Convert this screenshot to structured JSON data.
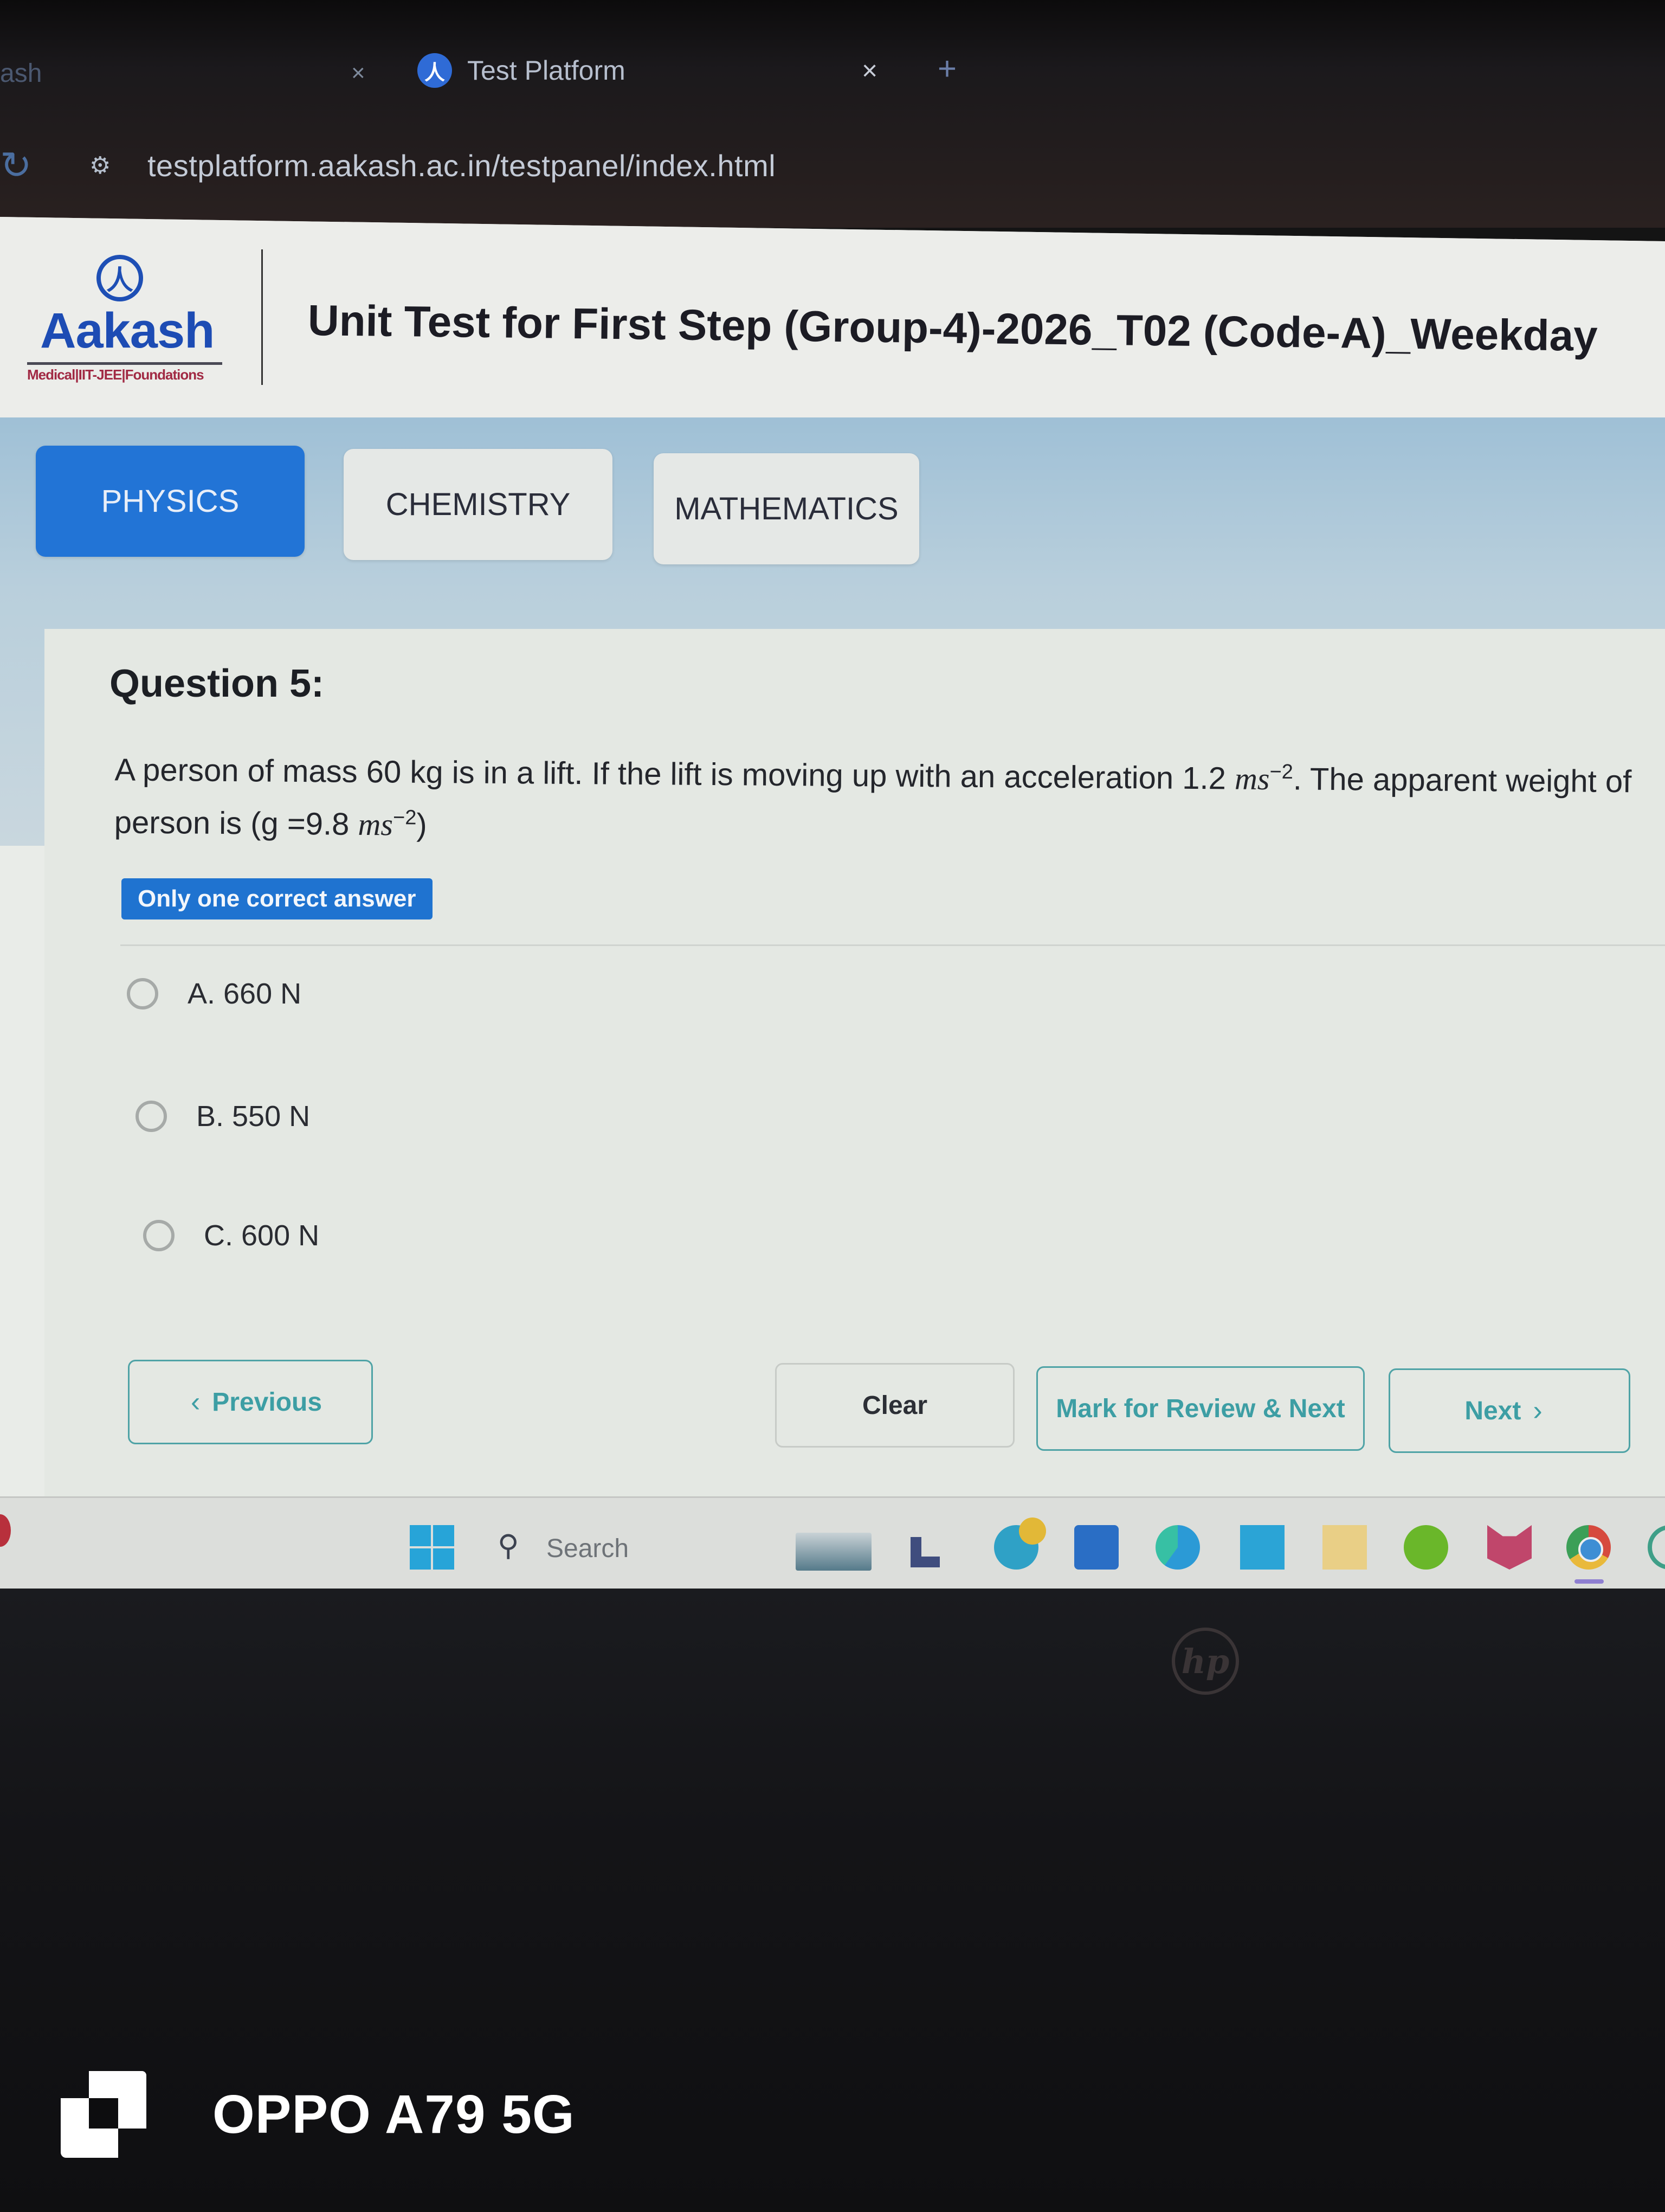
{
  "browser": {
    "tabs": [
      {
        "title": "ash",
        "close": "×",
        "active": false
      },
      {
        "title": "Test Platform",
        "close": "×",
        "active": true,
        "favicon": "aakash-favicon-icon"
      }
    ],
    "new_tab": "+",
    "reload_icon": "↻",
    "site_info_icon": "⚙",
    "url": "testplatform.aakash.ac.in/testpanel/index.html"
  },
  "header": {
    "logo": {
      "emblem": "人",
      "wordmark": "Aakash",
      "tagline": "Medical|IIT-JEE|Foundations"
    },
    "test_title": "Unit Test for First Step (Group-4)-2026_T02 (Code-A)_Weekday"
  },
  "subjects": [
    {
      "label": "PHYSICS",
      "active": true
    },
    {
      "label": "CHEMISTRY",
      "active": false
    },
    {
      "label": "MATHEMATICS",
      "active": false
    }
  ],
  "question": {
    "number_label": "Question 5:",
    "text_part1": "A person of mass 60 kg is in a lift. If the lift is moving up with an acceleration 1.2 ",
    "unit1": "ms",
    "exp1": "−2",
    "text_part2": ". The apparent weight of person is (g =9.8 ",
    "unit2": "ms",
    "exp2": "−2",
    "text_part3": ")",
    "answer_type": "Only one correct answer",
    "options": [
      {
        "label": "A. 660 N",
        "selected": false
      },
      {
        "label": "B. 550 N",
        "selected": false
      },
      {
        "label": "C. 600 N",
        "selected": false
      }
    ]
  },
  "navigation": {
    "previous": "Previous",
    "previous_icon": "‹",
    "clear": "Clear",
    "mark_review_next": "Mark for Review & Next",
    "next": "Next",
    "next_icon": "›"
  },
  "taskbar": {
    "search_label": "Search",
    "search_icon": "⚲",
    "apps": [
      "windows-start",
      "widgets",
      "l-app",
      "browser-globe",
      "microsoft-store",
      "edge",
      "mahp",
      "file-explorer",
      "duolingo",
      "mcafee",
      "chrome",
      "whatsapp"
    ]
  },
  "device": {
    "laptop_brand": "hp",
    "camera_watermark": "OPPO A79 5G"
  },
  "colors": {
    "accent_blue": "#2274d6",
    "nav_teal": "#3d9ea4",
    "logo_blue": "#1d4cb4",
    "logo_red": "#a12a44"
  }
}
